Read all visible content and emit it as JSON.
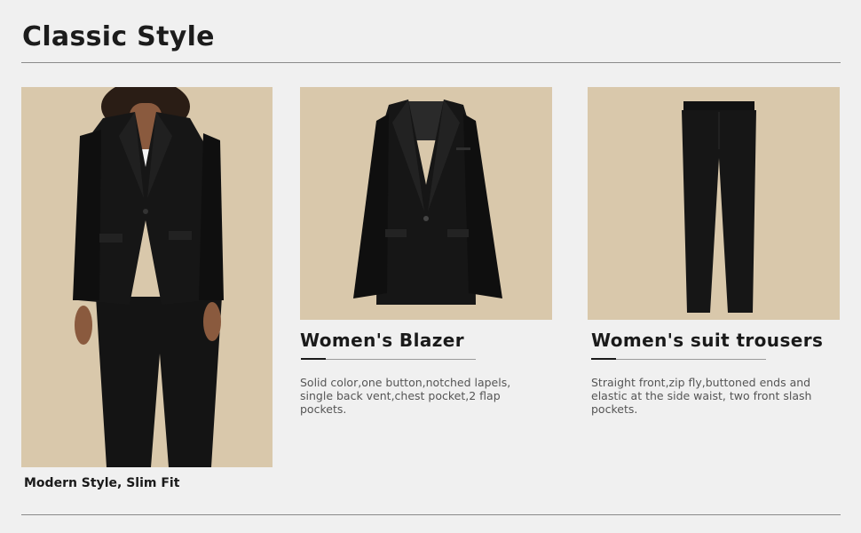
{
  "page": {
    "title": "Classic Style"
  },
  "model": {
    "caption": "Modern Style, Slim Fit"
  },
  "products": [
    {
      "title": "Women's Blazer",
      "description": "Solid color,one button,notched lapels, single back vent,chest pocket,2 flap pockets."
    },
    {
      "title": "Women's suit trousers",
      "description": "Straight front,zip fly,buttoned ends and elastic at the side waist, two front slash pockets."
    }
  ],
  "colors": {
    "background": "#f0f0f0",
    "photo_backdrop": "#d9c8ab",
    "garment": "#141414",
    "text": "#1a1a1a",
    "muted_text": "#555555"
  }
}
